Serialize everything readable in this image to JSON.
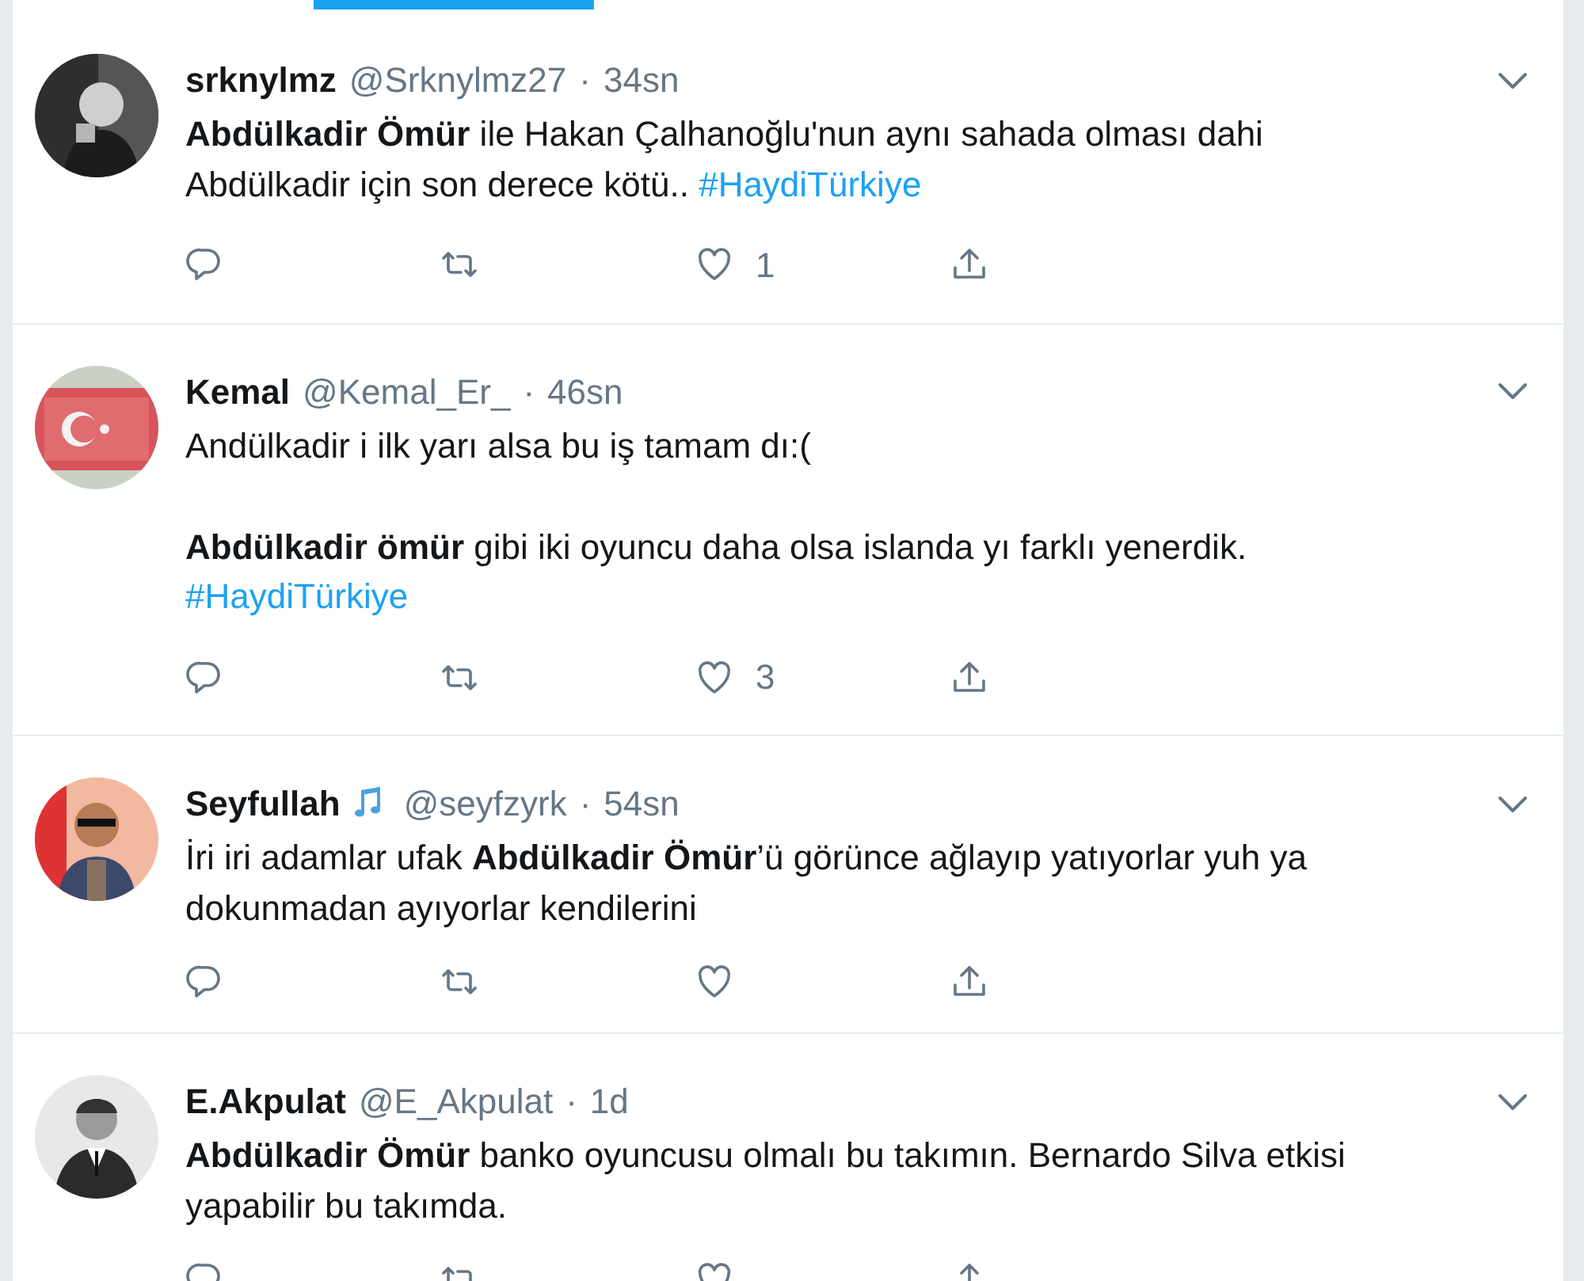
{
  "tabs_indicator": {
    "selected": true
  },
  "tweets": [
    {
      "name": "srknylmz",
      "badge": false,
      "handle": "@Srknylmz27",
      "separator": "·",
      "time": "34sn",
      "body": "**Abdülkadir Ömür** ile Hakan Çalhanoğlu'nun aynı sahada olması dahi\nAbdülkadir için son derece kötü..",
      "hashtag": "#HaydiTürkiye",
      "likes": "1"
    },
    {
      "name": "Kemal",
      "badge": false,
      "handle": "@Kemal_Er_",
      "separator": "·",
      "time": "46sn",
      "body": "Andülkadir i ilk yarı alsa bu iş tamam dı:(\n\n**Abdülkadir ömür** gibi iki oyuncu daha olsa islanda yı farklı yenerdik.\n",
      "hashtag": "#HaydiTürkiye",
      "likes": "3"
    },
    {
      "name": "Seyfullah",
      "badge": true,
      "handle": "@seyfzyrk",
      "separator": "·",
      "time": "54sn",
      "body": "İri iri adamlar ufak **Abdülkadir Ömür**’ü görünce ağlayıp yatıyorlar yuh ya\ndokunmadan ayıyorlar kendilerini"
    },
    {
      "name": "E.Akpulat",
      "badge": false,
      "handle": "@E_Akpulat",
      "separator": "·",
      "time": "1d",
      "body": "**Abdülkadir Ömür** banko oyuncusu olmalı bu takımın. Bernardo Silva etkisi\nyapabilir bu takımda."
    }
  ]
}
